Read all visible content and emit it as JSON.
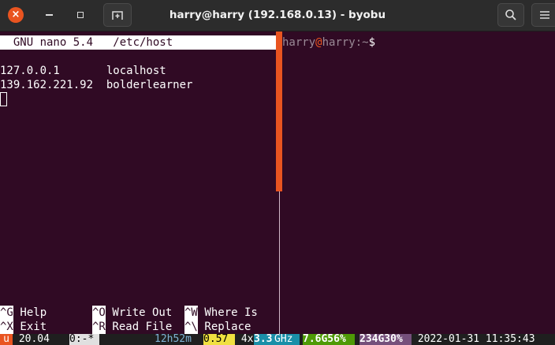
{
  "window": {
    "title": "harry@harry (192.168.0.13) - byobu",
    "close_glyph": "×"
  },
  "nano": {
    "header": "  GNU nano 5.4   /etc/host",
    "lines": [
      "127.0.0.1       localhost",
      "139.162.221.92  bolderlearner"
    ],
    "shortcuts": {
      "row1": [
        {
          "key": "^G",
          "label": " Help"
        },
        {
          "key": "^O",
          "label": " Write Out"
        },
        {
          "key": "^W",
          "label": " Where Is"
        }
      ],
      "row2": [
        {
          "key": "^X",
          "label": " Exit"
        },
        {
          "key": "^R",
          "label": " Read File"
        },
        {
          "key": "^\\",
          "label": " Replace"
        }
      ]
    }
  },
  "shell": {
    "user": "harry",
    "at": "@",
    "host": "harry",
    "path": ":~",
    "dollar": "$"
  },
  "statusbar": {
    "logo": "u",
    "release": " 20.04 ",
    "window": "0:-*",
    "uptime": "12h52m",
    "load": "0.57",
    "cpu_count": " 4x",
    "cpu_freq": "3.3",
    "cpu_unit": "GHz",
    "mem": "7.6G56%",
    "disk": "234G30%",
    "datetime": " 2022-01-31 11:35:43"
  },
  "colors": {
    "terminal_bg": "#300a24",
    "accent": "#e95420",
    "titlebar": "#2c2c2c"
  },
  "icons": {
    "close": "close-icon",
    "minimize": "minimize-icon",
    "maximize": "maximize-icon",
    "new_tab": "new-tab-icon",
    "search": "search-icon",
    "menu": "hamburger-menu-icon"
  }
}
